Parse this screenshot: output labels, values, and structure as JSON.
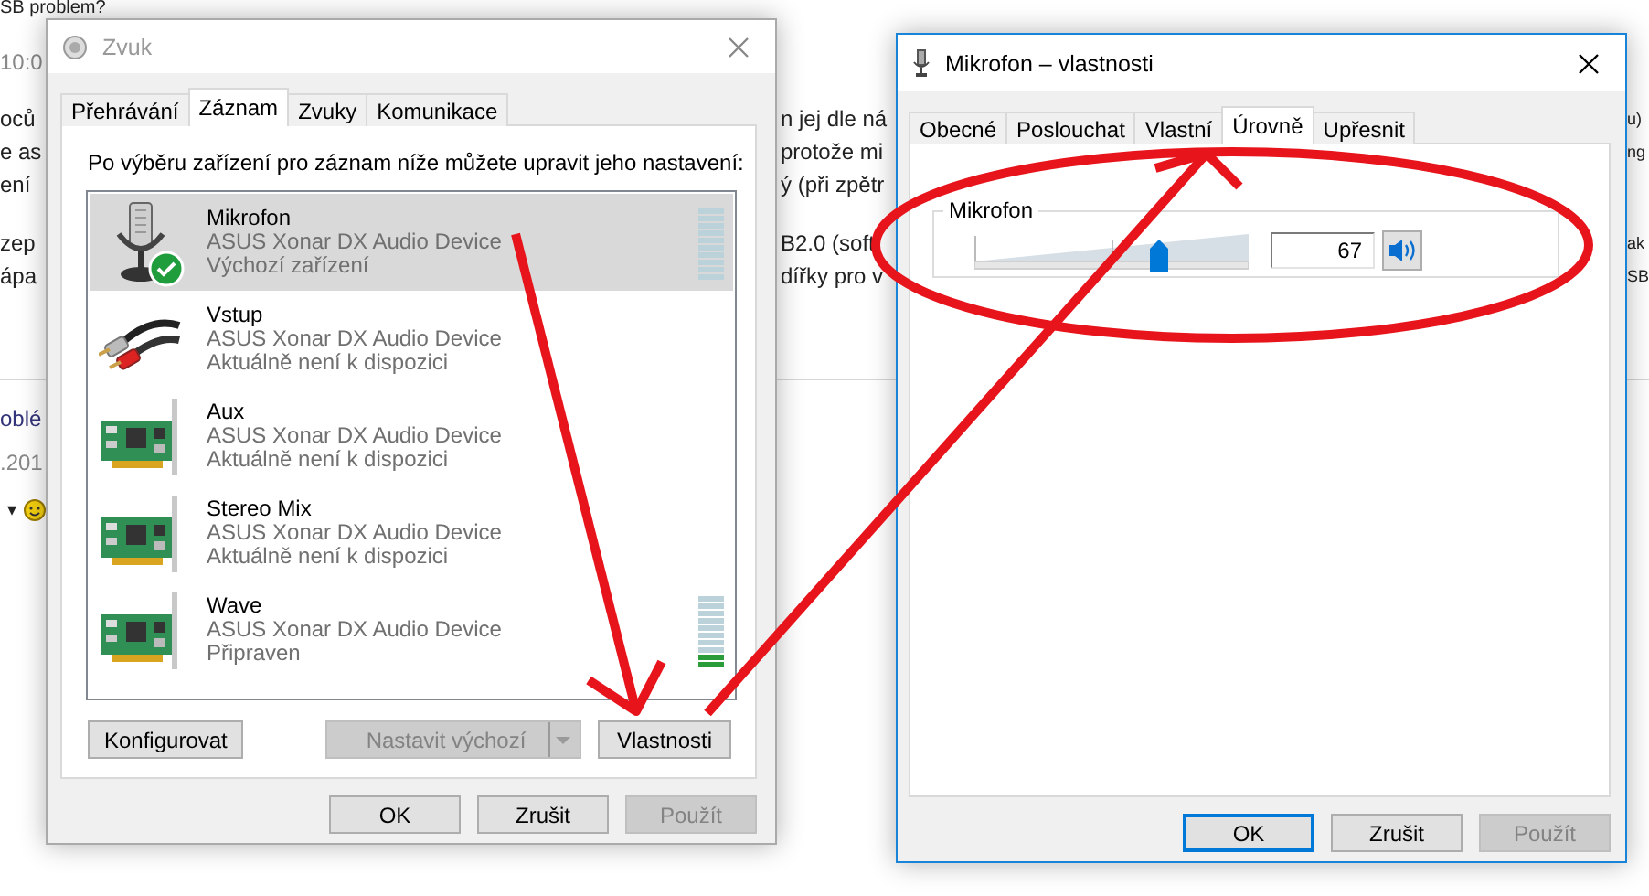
{
  "page": {
    "title": "SB problem?",
    "time": "10:0",
    "paragraphs": [
      [
        {
          "left": "oců",
          "middle": "n jej dle ná",
          "right": "u)"
        },
        {
          "left": "e as",
          "middle": "protože mi",
          "right": "ng"
        },
        {
          "left": "ení",
          "middle": "ý (při zpětr"
        }
      ],
      [
        {
          "left": "zep",
          "middle": "B2.0 (soft",
          "right": "ak"
        },
        {
          "left": "ápa",
          "middle": "dířky pro v",
          "right": "SB"
        }
      ]
    ],
    "link": "oblé",
    "date": ".201",
    "caret": "▾"
  },
  "sound_dialog": {
    "title": "Zvuk",
    "active": false,
    "tabs": [
      {
        "label": "Přehrávání",
        "selected": false
      },
      {
        "label": "Záznam",
        "selected": true
      },
      {
        "label": "Zvuky",
        "selected": false
      },
      {
        "label": "Komunikace",
        "selected": false
      }
    ],
    "instruction": "Po výběru zařízení pro záznam níže můžete upravit jeho nastavení:",
    "devices": [
      {
        "kind": "microphone",
        "name": "Mikrofon",
        "device": "ASUS Xonar DX Audio Device",
        "status": "Výchozí zařízení",
        "selected": true,
        "default": true,
        "level": 0
      },
      {
        "kind": "cable",
        "name": "Vstup",
        "device": "ASUS Xonar DX Audio Device",
        "status": "Aktuálně není k dispozici",
        "selected": false,
        "default": false
      },
      {
        "kind": "card",
        "name": "Aux",
        "device": "ASUS Xonar DX Audio Device",
        "status": "Aktuálně není k dispozici",
        "selected": false,
        "default": false
      },
      {
        "kind": "card",
        "name": "Stereo Mix",
        "device": "ASUS Xonar DX Audio Device",
        "status": "Aktuálně není k dispozici",
        "selected": false,
        "default": false
      },
      {
        "kind": "card",
        "name": "Wave",
        "device": "ASUS Xonar DX Audio Device",
        "status": "Připraven",
        "selected": false,
        "default": false,
        "level": 0.2
      }
    ],
    "actions": [
      {
        "kind": "plain",
        "label": "Konfigurovat",
        "disabled": false
      },
      {
        "kind": "split",
        "label": "Nastavit výchozí",
        "disabled": true
      },
      {
        "kind": "plain",
        "label": "Vlastnosti",
        "disabled": false
      }
    ],
    "buttons": [
      {
        "label": "OK",
        "disabled": false,
        "focused": false
      },
      {
        "label": "Zrušit",
        "disabled": false,
        "focused": false
      },
      {
        "label": "Použít",
        "disabled": true,
        "focused": false
      }
    ]
  },
  "properties_dialog": {
    "title": "Mikrofon – vlastnosti",
    "active": true,
    "tabs": [
      {
        "label": "Obecné",
        "selected": false
      },
      {
        "label": "Poslouchat",
        "selected": false
      },
      {
        "label": "Vlastní",
        "selected": false
      },
      {
        "label": "Úrovně",
        "selected": true
      },
      {
        "label": "Upřesnit",
        "selected": false
      }
    ],
    "group": "Mikrofon",
    "level": 0.67,
    "value": "67",
    "muted": false,
    "buttons": [
      {
        "label": "OK",
        "disabled": false,
        "focused": true
      },
      {
        "label": "Zrušit",
        "disabled": false,
        "focused": false
      },
      {
        "label": "Použít",
        "disabled": true,
        "focused": false
      }
    ]
  },
  "markup": [
    {
      "kind": "ellipse"
    },
    {
      "kind": "arrow"
    },
    {
      "kind": "arrow"
    }
  ]
}
